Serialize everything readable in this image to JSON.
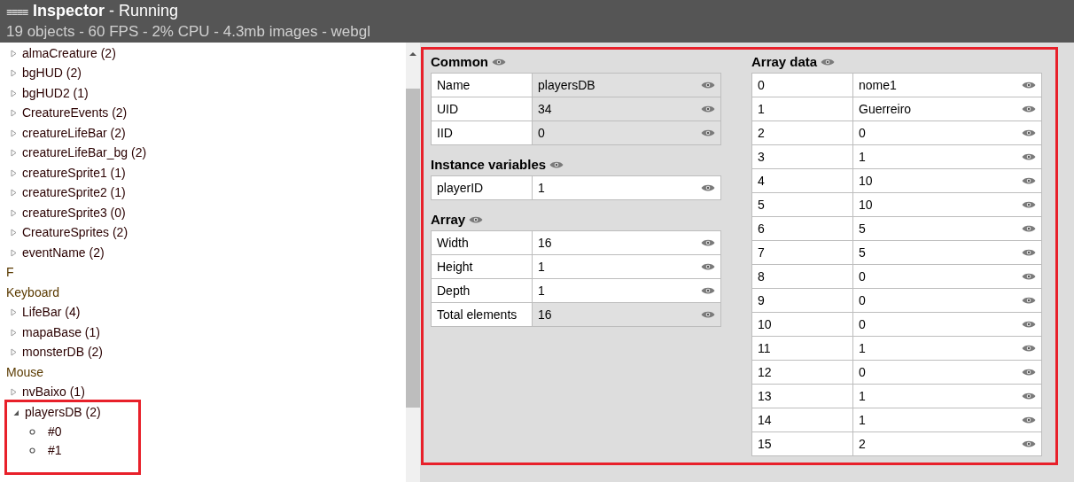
{
  "header": {
    "menu_icon": "≡≡≡≡",
    "title": "Inspector",
    "subtitle": " - Running",
    "status": "19 objects - 60 FPS - 2% CPU - 4.3mb images - webgl"
  },
  "tree": [
    {
      "kind": "type",
      "label": "almaCreature (2)",
      "expanded": false
    },
    {
      "kind": "type",
      "label": "bgHUD (2)",
      "expanded": false
    },
    {
      "kind": "type",
      "label": "bgHUD2 (1)",
      "expanded": false
    },
    {
      "kind": "type",
      "label": "CreatureEvents (2)",
      "expanded": false
    },
    {
      "kind": "type",
      "label": "creatureLifeBar (2)",
      "expanded": false
    },
    {
      "kind": "type",
      "label": "creatureLifeBar_bg (2)",
      "expanded": false
    },
    {
      "kind": "type",
      "label": "creatureSprite1 (1)",
      "expanded": false
    },
    {
      "kind": "type",
      "label": "creatureSprite2 (1)",
      "expanded": false
    },
    {
      "kind": "type",
      "label": "creatureSprite3 (0)",
      "expanded": false
    },
    {
      "kind": "type",
      "label": "CreatureSprites (2)",
      "expanded": false
    },
    {
      "kind": "type",
      "label": "eventName (2)",
      "expanded": false
    },
    {
      "kind": "plain",
      "label": "F"
    },
    {
      "kind": "plain",
      "label": "Keyboard"
    },
    {
      "kind": "type",
      "label": "LifeBar (4)",
      "expanded": false
    },
    {
      "kind": "type",
      "label": "mapaBase (1)",
      "expanded": false
    },
    {
      "kind": "type",
      "label": "monsterDB (2)",
      "expanded": false
    },
    {
      "kind": "plain",
      "label": "Mouse"
    },
    {
      "kind": "type",
      "label": "nvBaixo (1)",
      "expanded": false
    },
    {
      "kind": "type",
      "label": "playersDB (2)",
      "expanded": true,
      "highlighted": true,
      "children": [
        {
          "label": "#0"
        },
        {
          "label": "#1"
        }
      ]
    }
  ],
  "inspector": {
    "highlighted": true,
    "left_sections": [
      {
        "title": "Common",
        "rows": [
          {
            "key": "Name",
            "value": "playersDB",
            "readonly": true
          },
          {
            "key": "UID",
            "value": "34",
            "readonly": true
          },
          {
            "key": "IID",
            "value": "0",
            "readonly": true
          }
        ]
      },
      {
        "title": "Instance variables",
        "rows": [
          {
            "key": "playerID",
            "value": "1",
            "readonly": false
          }
        ]
      },
      {
        "title": "Array",
        "rows": [
          {
            "key": "Width",
            "value": "16",
            "readonly": false
          },
          {
            "key": "Height",
            "value": "1",
            "readonly": false
          },
          {
            "key": "Depth",
            "value": "1",
            "readonly": false
          },
          {
            "key": "Total elements",
            "value": "16",
            "readonly": true
          }
        ]
      }
    ],
    "right_sections": [
      {
        "title": "Array data",
        "rows": [
          {
            "key": "0",
            "value": "nome1",
            "readonly": false
          },
          {
            "key": "1",
            "value": "Guerreiro",
            "readonly": false
          },
          {
            "key": "2",
            "value": "0",
            "readonly": false
          },
          {
            "key": "3",
            "value": "1",
            "readonly": false
          },
          {
            "key": "4",
            "value": "10",
            "readonly": false
          },
          {
            "key": "5",
            "value": "10",
            "readonly": false
          },
          {
            "key": "6",
            "value": "5",
            "readonly": false
          },
          {
            "key": "7",
            "value": "5",
            "readonly": false
          },
          {
            "key": "8",
            "value": "0",
            "readonly": false
          },
          {
            "key": "9",
            "value": "0",
            "readonly": false
          },
          {
            "key": "10",
            "value": "0",
            "readonly": false
          },
          {
            "key": "11",
            "value": "1",
            "readonly": false
          },
          {
            "key": "12",
            "value": "0",
            "readonly": false
          },
          {
            "key": "13",
            "value": "1",
            "readonly": false
          },
          {
            "key": "14",
            "value": "1",
            "readonly": false
          },
          {
            "key": "15",
            "value": "2",
            "readonly": false
          }
        ]
      }
    ]
  }
}
